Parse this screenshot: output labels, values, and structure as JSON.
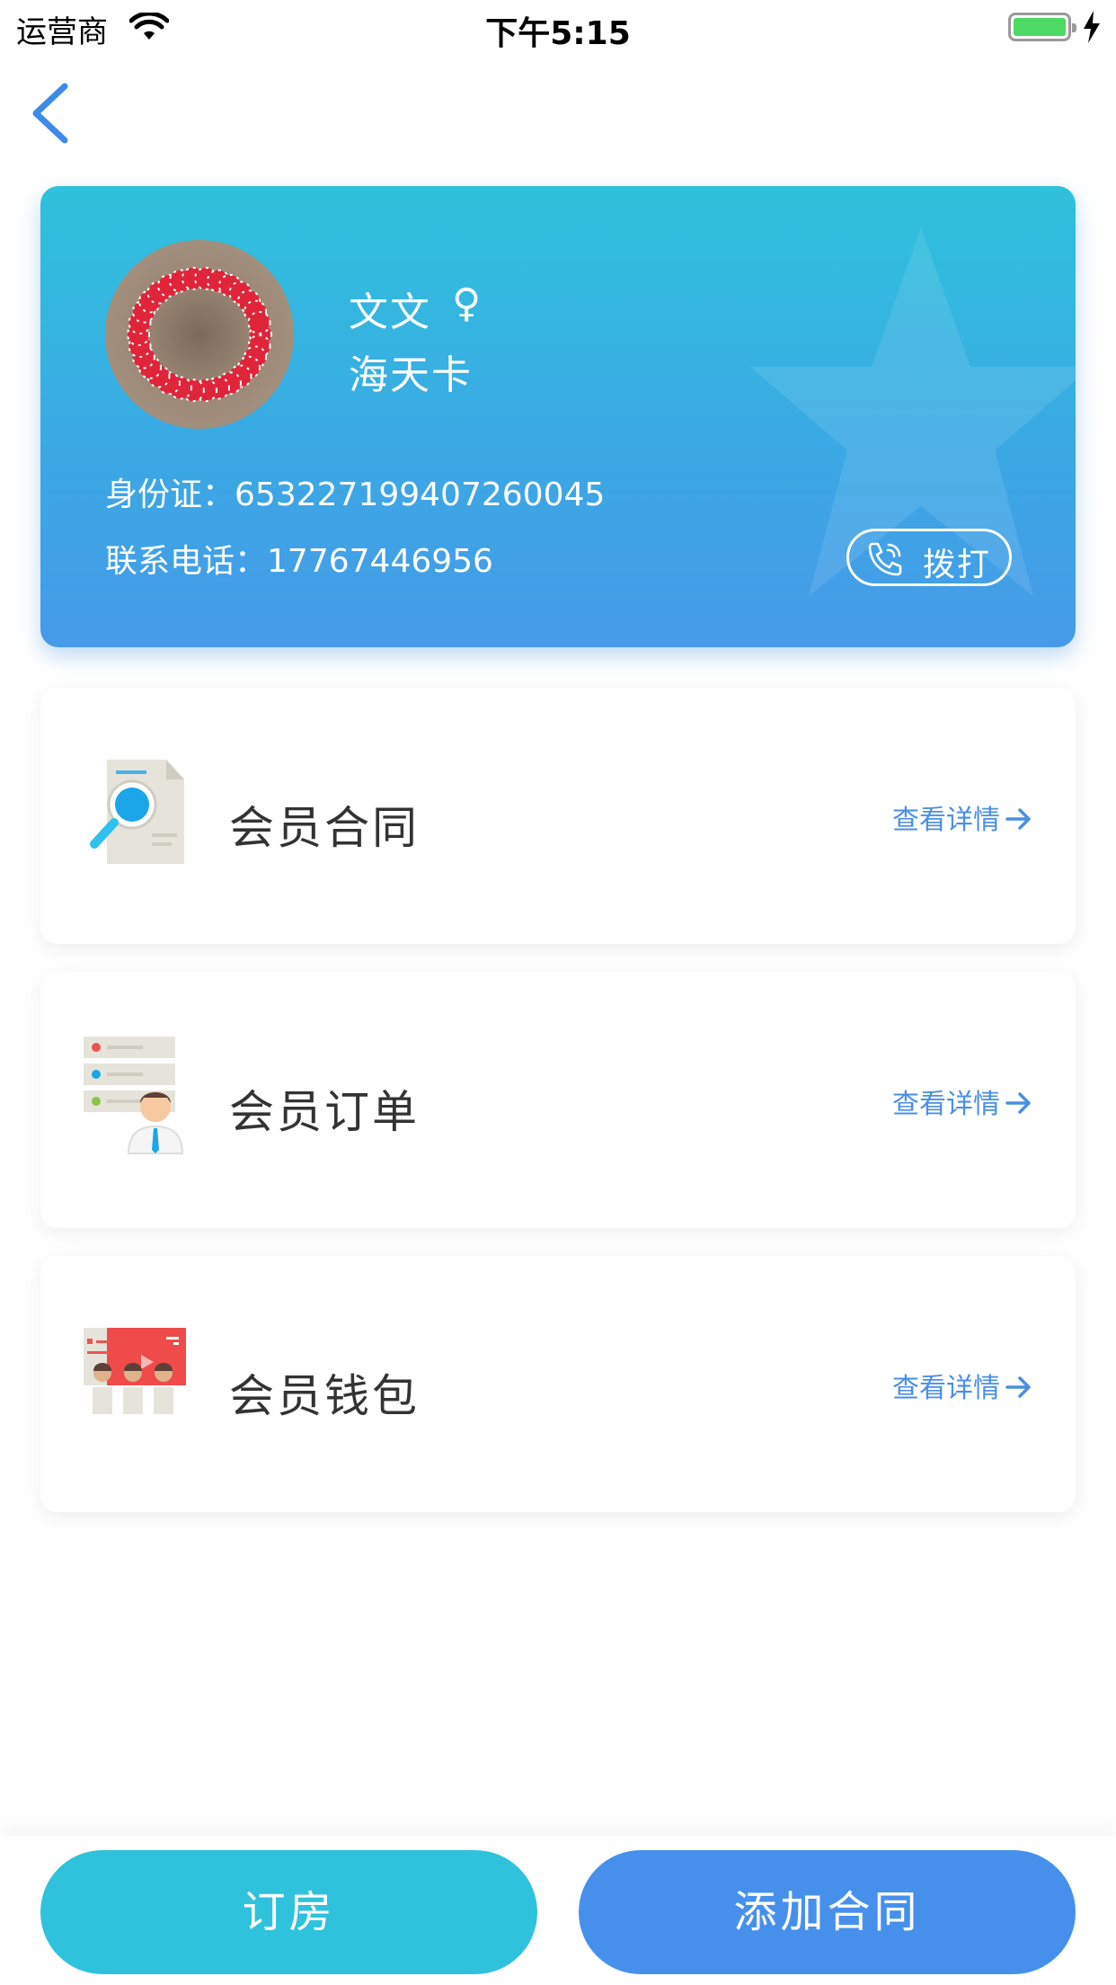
{
  "status_bar": {
    "carrier": "运营商",
    "time": "下午5:15"
  },
  "member": {
    "name": "文文",
    "gender_symbol": "♀",
    "card_type": "海天卡",
    "id_label": "身份证：",
    "id_number": "653227199407260045",
    "phone_label": "联系电话：",
    "phone_number": "17767446956",
    "dial_label": "拨打"
  },
  "menu": [
    {
      "title": "会员合同",
      "link": "查看详情",
      "icon": "contract-search-icon"
    },
    {
      "title": "会员订单",
      "link": "查看详情",
      "icon": "order-list-person-icon"
    },
    {
      "title": "会员钱包",
      "link": "查看详情",
      "icon": "wallet-group-icon"
    }
  ],
  "bottom": {
    "book_room": "订房",
    "add_contract": "添加合同"
  },
  "colors": {
    "accent_cyan": "#2fc2dc",
    "accent_blue": "#4690ec",
    "link_blue": "#4a8fe3"
  }
}
